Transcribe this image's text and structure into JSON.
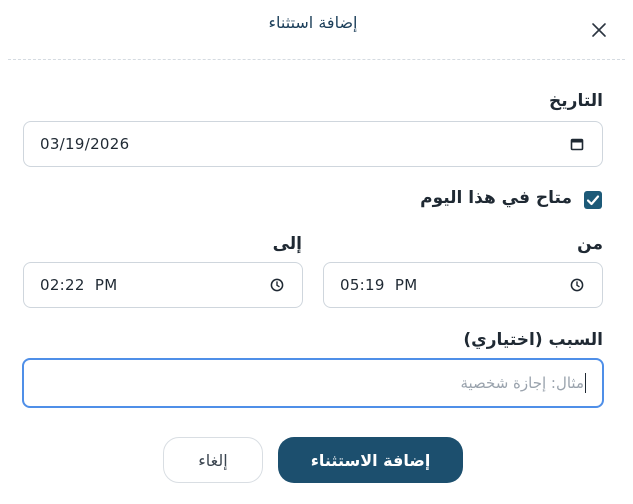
{
  "dialog": {
    "title": "إضافة استثناء",
    "close_icon": "close-icon"
  },
  "date": {
    "label": "التاريخ",
    "value": "03/19/2026",
    "icon": "calendar-icon"
  },
  "available": {
    "label": "متاح في هذا اليوم",
    "checked": true,
    "color": "#1d5a78"
  },
  "time_from": {
    "label": "من",
    "value": "05:19  PM",
    "icon": "clock-icon"
  },
  "time_to": {
    "label": "إلى",
    "value": "02:22  PM",
    "icon": "clock-icon"
  },
  "reason": {
    "label": "السبب (اختياري)",
    "placeholder": "مثال: إجازة شخصية"
  },
  "actions": {
    "submit_label": "إضافة الاستثناء",
    "cancel_label": "إلغاء",
    "primary_color": "#1c4f6e",
    "focus_color": "#4f8fe8"
  }
}
